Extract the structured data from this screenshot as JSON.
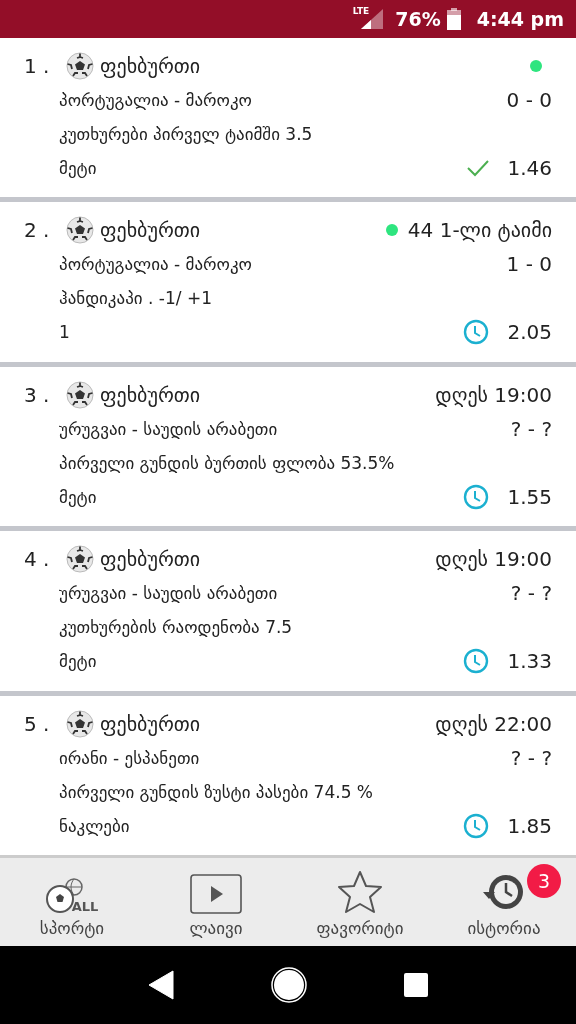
{
  "status_bar": {
    "network": "LTE",
    "battery": "76%",
    "time": "4:44 pm"
  },
  "bets": [
    {
      "number": "1 .",
      "sport": "ფეხბურთი",
      "live": true,
      "teams": "პორტუგალია - მაროკო",
      "score": "0 - 0",
      "market": "კუთხურები პირველ ტაიმში 3.5",
      "selection": "მეტი",
      "kind": "won",
      "odds": "1.46"
    },
    {
      "number": "2 .",
      "sport": "ფეხბურთი",
      "live": true,
      "match_time": "44 1-ლი ტაიმი",
      "teams": "პორტუგალია - მაროკო",
      "score": "1 - 0",
      "market": "ჰანდიკაპი . -1/ +1",
      "selection": "1",
      "kind": "pending",
      "odds": "2.05"
    },
    {
      "number": "3 .",
      "sport": "ფეხბურთი",
      "live": false,
      "match_time": "დღეს 19:00",
      "teams": "ურუგვაი - საუდის არაბეთი",
      "score": "? - ?",
      "market": "პირველი გუნდის ბურთის ფლობა 53.5%",
      "selection": "მეტი",
      "kind": "pending",
      "odds": "1.55"
    },
    {
      "number": "4 .",
      "sport": "ფეხბურთი",
      "live": false,
      "match_time": "დღეს 19:00",
      "teams": "ურუგვაი - საუდის არაბეთი",
      "score": "? - ?",
      "market": "კუთხურების რაოდენობა 7.5",
      "selection": "მეტი",
      "kind": "pending",
      "odds": "1.33"
    },
    {
      "number": "5 .",
      "sport": "ფეხბურთი",
      "live": false,
      "match_time": "დღეს 22:00",
      "teams": "ირანი - ესპანეთი",
      "score": "? - ?",
      "market": "პირველი გუნდის ზუსტი პასები 74.5 %",
      "selection": "ნაკლები",
      "kind": "pending",
      "odds": "1.85"
    }
  ],
  "bottom_nav": [
    {
      "kind": "sports",
      "label": "სპორტი",
      "icon_text": "ALL"
    },
    {
      "kind": "live",
      "label": "ლაივი"
    },
    {
      "kind": "favorites",
      "label": "ფავორიტი"
    },
    {
      "kind": "history",
      "label": "ისტორია",
      "badge": "3"
    }
  ]
}
